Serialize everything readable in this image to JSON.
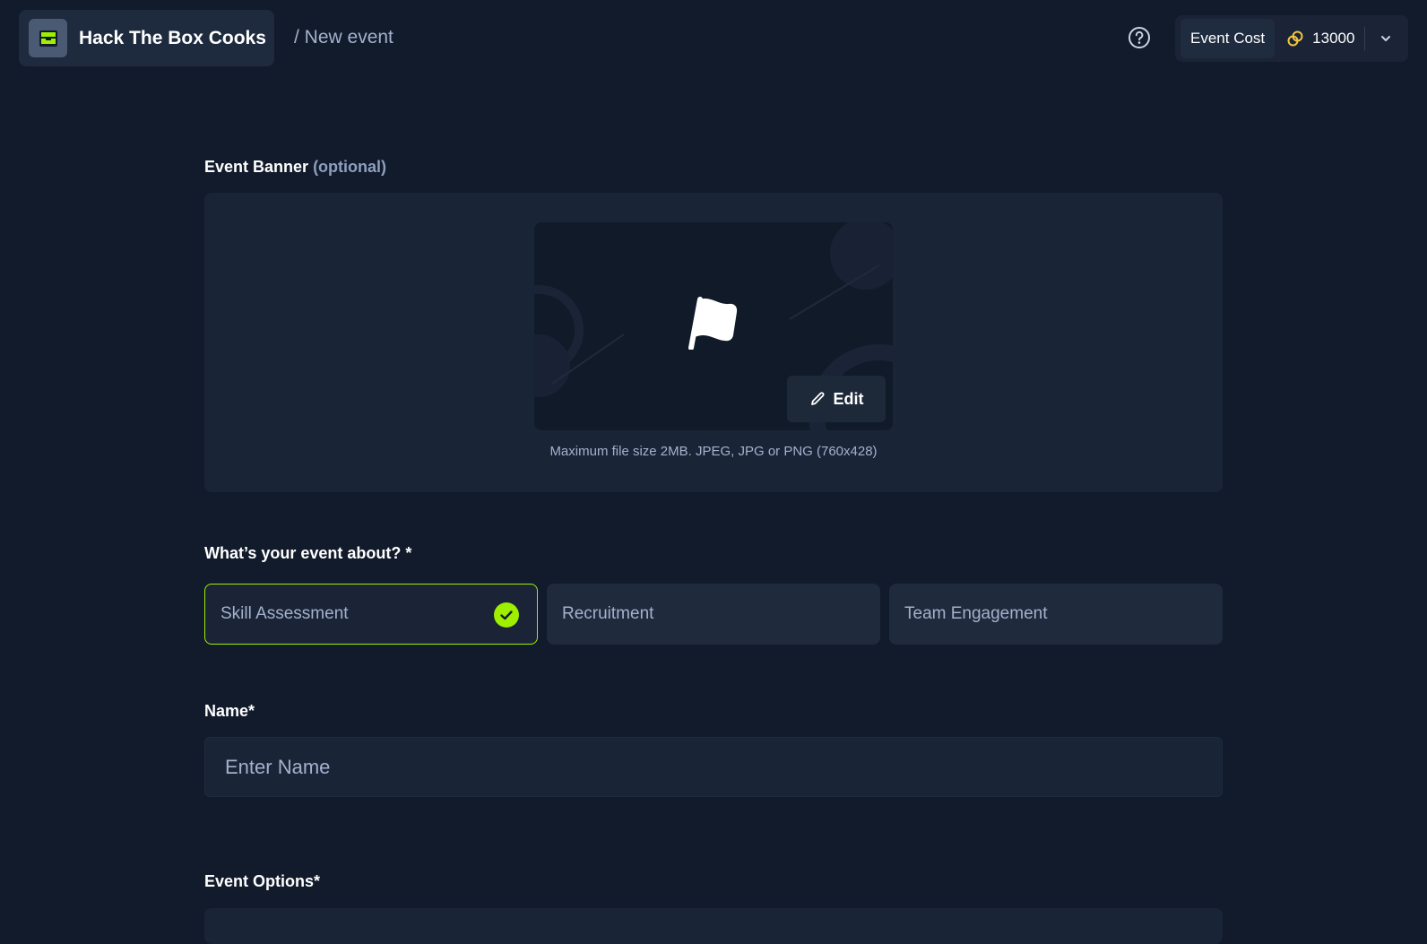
{
  "header": {
    "org_name": "Hack The Box Cooks",
    "breadcrumb": "/ New event",
    "event_cost_label": "Event Cost",
    "event_cost_value": "13000"
  },
  "form": {
    "banner": {
      "label": "Event Banner",
      "optional": "(optional)",
      "edit_label": "Edit",
      "hint": "Maximum file size 2MB. JPEG, JPG or PNG (760x428)"
    },
    "about": {
      "label": "What’s your event about? *",
      "options": [
        {
          "label": "Skill Assessment",
          "selected": true
        },
        {
          "label": "Recruitment",
          "selected": false
        },
        {
          "label": "Team Engagement",
          "selected": false
        }
      ]
    },
    "name": {
      "label": "Name*",
      "placeholder": "Enter Name",
      "value": ""
    },
    "event_options": {
      "label": "Event Options*"
    }
  },
  "colors": {
    "background": "#121b2b",
    "panel": "#1a2437",
    "accent": "#9fef00",
    "coin": "#f5c542"
  },
  "icons": [
    "org-logo-icon",
    "help-icon",
    "coins-icon",
    "chevron-down-icon",
    "flag-icon",
    "pencil-icon",
    "check-circle-icon"
  ]
}
